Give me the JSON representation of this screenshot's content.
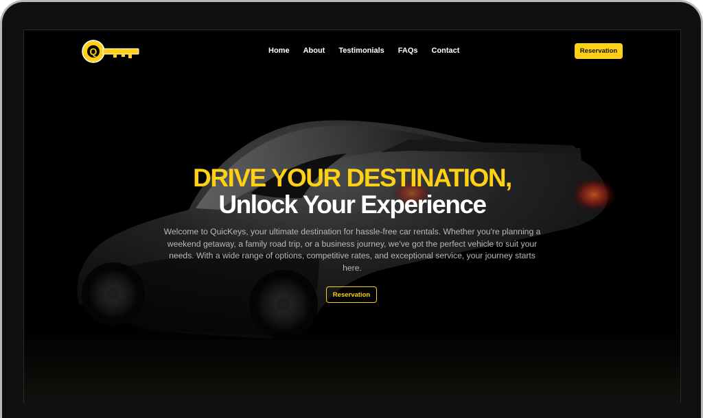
{
  "brand": {
    "accent_color": "#ffd116",
    "logo_icon": "key-icon"
  },
  "nav": {
    "links": [
      "Home",
      "About",
      "Testimonials",
      "FAQs",
      "Contact"
    ],
    "cta_label": "Reservation"
  },
  "hero": {
    "headline_line1": "DRIVE YOUR DESTINATION,",
    "headline_line2": "Unlock Your Experience",
    "intro": "Welcome to QuicKeys, your ultimate destination for hassle-free car rentals. Whether you're planning a weekend getaway, a family road trip, or a business journey, we've got the perfect vehicle to suit your needs. With a wide range of options, competitive rates, and exceptional service, your journey starts here.",
    "cta_label": "Reservation",
    "background_image": "dark sports car"
  }
}
